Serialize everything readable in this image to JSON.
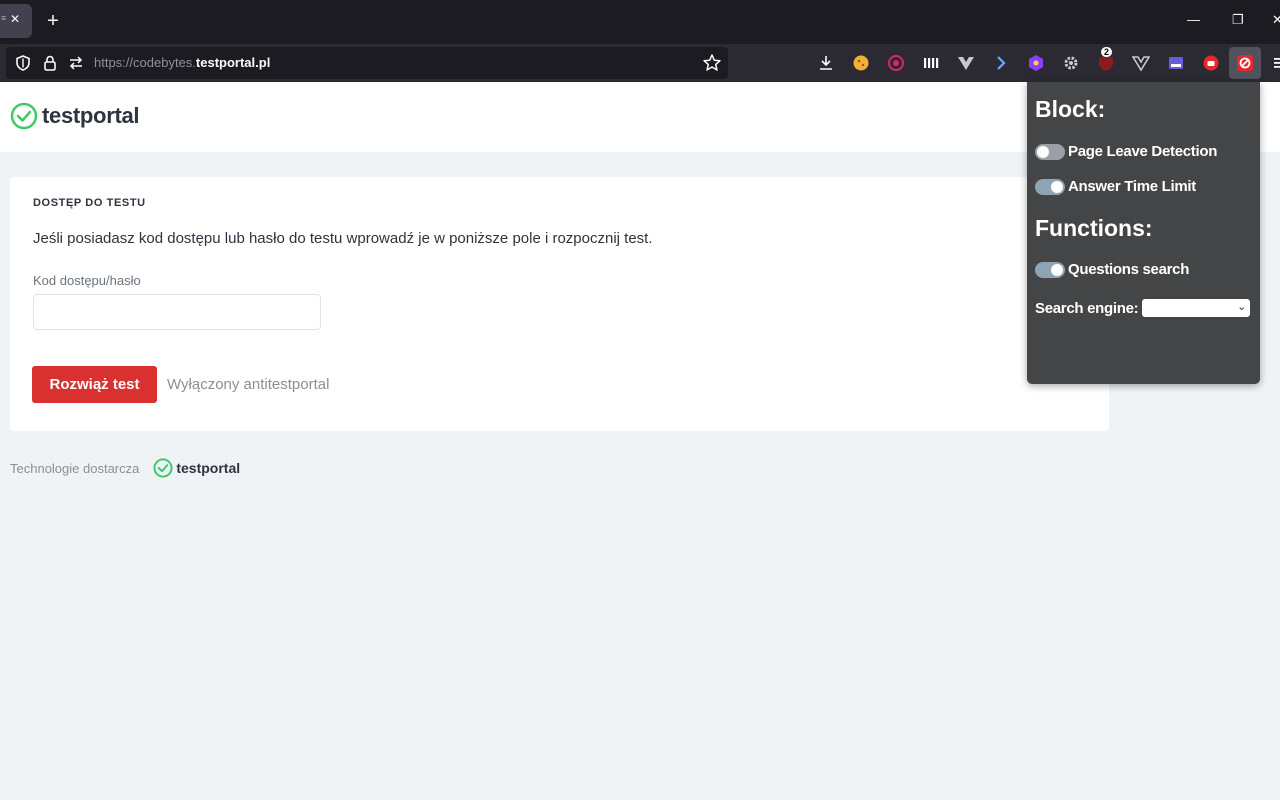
{
  "browser": {
    "tab": {
      "close_glyph": "✕"
    },
    "new_tab_glyph": "+",
    "window_controls": {
      "minimize": "—",
      "restore": "❐",
      "close": "✕"
    },
    "url": {
      "prefix": "https://codebytes.",
      "domain": "testportal.pl"
    },
    "toolbar_icons": [
      "shield-icon",
      "lock-icon",
      "permissions-icon",
      "bookmark-star-icon",
      "download-icon",
      "extension-icons"
    ],
    "extension_badge": "2"
  },
  "site": {
    "logo_text": "testportal",
    "brand_color": "#3ec96a"
  },
  "card": {
    "heading": "DOSTĘP DO TESTU",
    "description": "Jeśli posiadasz kod dostępu lub hasło do testu wprowadź je w poniższe pole i rozpocznij test.",
    "field_label": "Kod dostępu/hasło",
    "field_value": "",
    "solve_button": "Rozwiąż test",
    "status_text": "Wyłączony antitestportal",
    "button_color": "#d9312f"
  },
  "footer": {
    "text": "Technologie dostarcza",
    "logo_text": "testportal"
  },
  "popup": {
    "block_heading": "Block:",
    "functions_heading": "Functions:",
    "toggles": [
      {
        "label": "Page Leave Detection",
        "on": false
      },
      {
        "label": "Answer Time Limit",
        "on": true
      },
      {
        "label": "Questions search",
        "on": true
      }
    ],
    "search_engine_label": "Search engine:",
    "search_engine_value": ""
  }
}
